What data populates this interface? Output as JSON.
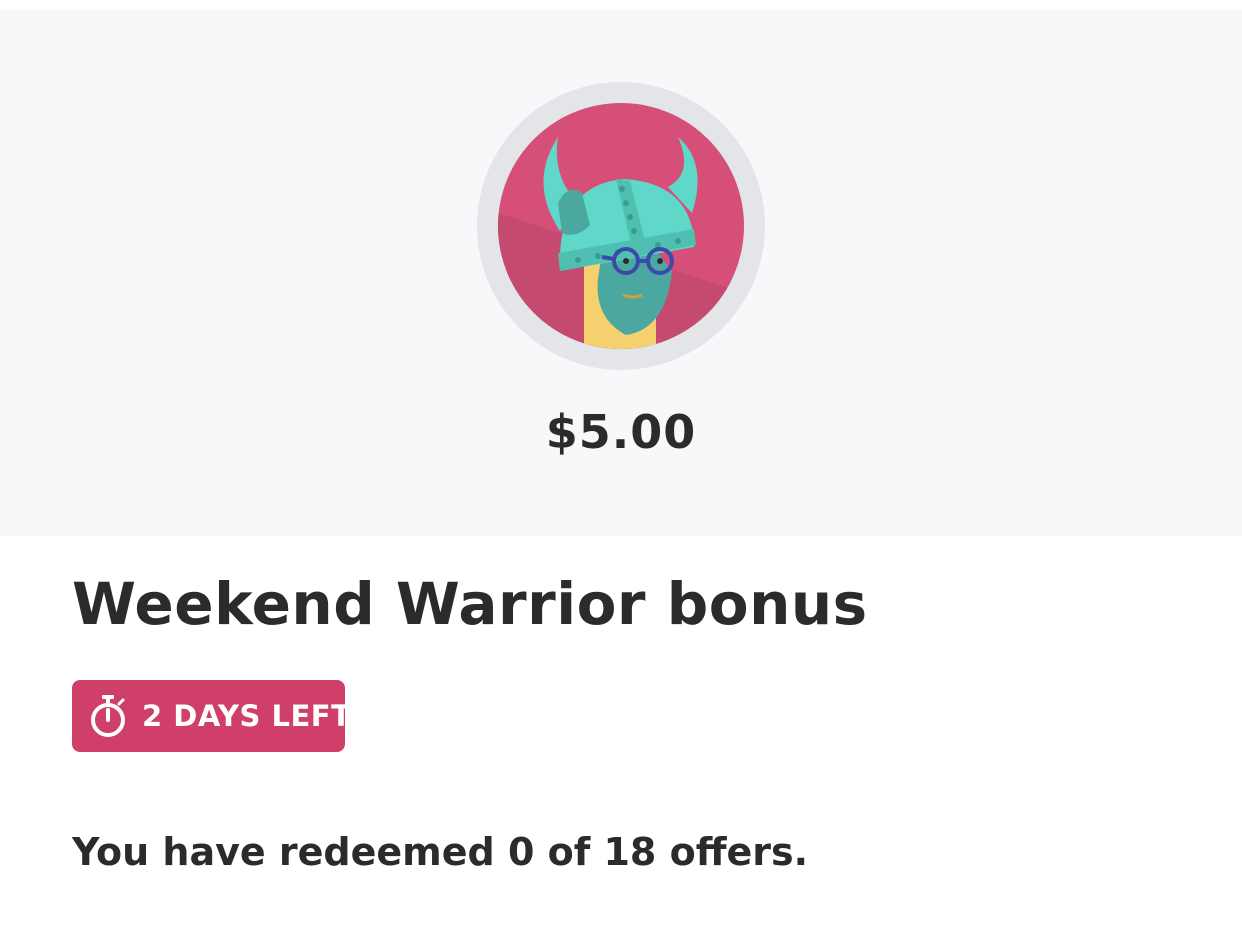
{
  "offer": {
    "amount": "$5.00",
    "title": "Weekend Warrior bonus",
    "badge": {
      "icon": "stopwatch-icon",
      "label": "2 DAYS LEFT",
      "color": "#cf3f69"
    },
    "redeemed_text": "You have redeemed 0 of 18 offers."
  },
  "avatar": {
    "icon": "viking-avatar-icon",
    "ring_color": "#e4e5e8",
    "background_color": "#d64f79",
    "helmet_color": "#5fd8c9",
    "face_color": "#f5d06e"
  },
  "colors": {
    "hero_background": "#f7f8fa",
    "text": "#2b2b2b"
  }
}
